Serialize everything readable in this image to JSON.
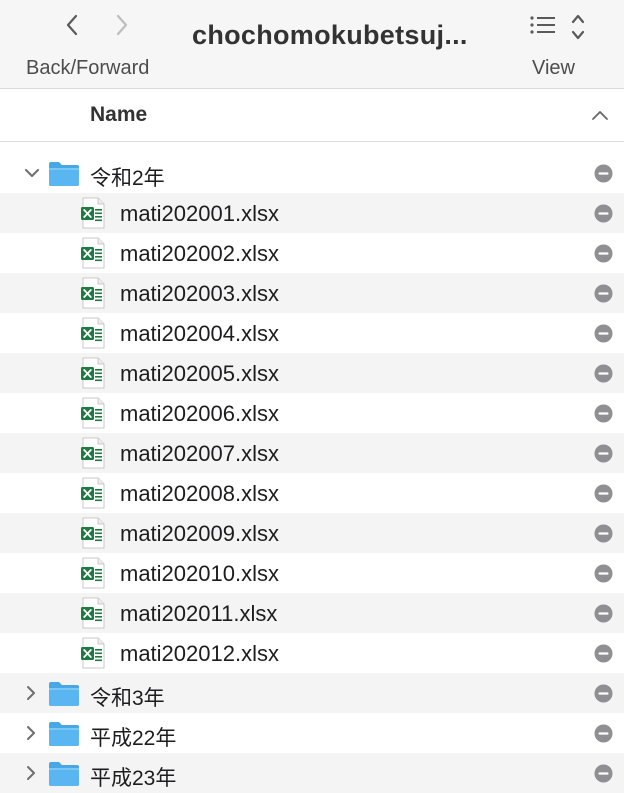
{
  "toolbar": {
    "nav_label": "Back/Forward",
    "window_title": "chochomokubetsuj...",
    "view_label": "View"
  },
  "header": {
    "column_name": "Name"
  },
  "colors": {
    "folder_blue": "#5ab6f0",
    "excel_green": "#1d7a42",
    "remove_gray": "#8e8e93"
  },
  "folders": [
    {
      "name": "令和2年",
      "expanded": true,
      "files": [
        "mati202001.xlsx",
        "mati202002.xlsx",
        "mati202003.xlsx",
        "mati202004.xlsx",
        "mati202005.xlsx",
        "mati202006.xlsx",
        "mati202007.xlsx",
        "mati202008.xlsx",
        "mati202009.xlsx",
        "mati202010.xlsx",
        "mati202011.xlsx",
        "mati202012.xlsx"
      ]
    },
    {
      "name": "令和3年",
      "expanded": false,
      "files": []
    },
    {
      "name": "平成22年",
      "expanded": false,
      "files": []
    },
    {
      "name": "平成23年",
      "expanded": false,
      "files": []
    }
  ]
}
